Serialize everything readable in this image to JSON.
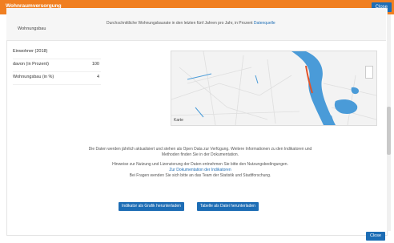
{
  "header": {
    "title": "Wohnraumversorgung",
    "close_label": "Close"
  },
  "upper": {
    "label": "Wohnungsbau",
    "text": "Durchschnittliche Wohnungsbaurate in den letzten fünf Jahren pro Jahr, in Prozent",
    "link": "Datenquelle"
  },
  "stats": [
    {
      "label": "Einwohner (2018)",
      "value": ""
    },
    {
      "label": "davon (in Prozent)",
      "value": "100"
    },
    {
      "label": "Wohnungsbau (in %)",
      "value": "4"
    }
  ],
  "map": {
    "label": "Karte"
  },
  "info": {
    "p1": "Die Daten werden jährlich aktualisiert und stehen als Open Data zur Verfügung. Weitere Informationen zu den Indikatoren und Methoden finden Sie in der Dokumentation.",
    "p2a": "Hinweise zur Nutzung und Lizenzierung der Daten entnehmen Sie bitte den Nutzungsbedingungen.",
    "p2link": "Zur Dokumentation der Indikatoren",
    "p2b": "Bei Fragen wenden Sie sich bitte an das Team der Statistik und Stadtforschung."
  },
  "buttons": {
    "left": "Indikator als Grafik herunterladen",
    "right": "Tabelle als Datei herunterladen",
    "close": "Close"
  },
  "colors": {
    "accent": "#f07f21",
    "primary": "#1d6db5",
    "water": "#4a9bd8",
    "route": "#e0532a"
  }
}
